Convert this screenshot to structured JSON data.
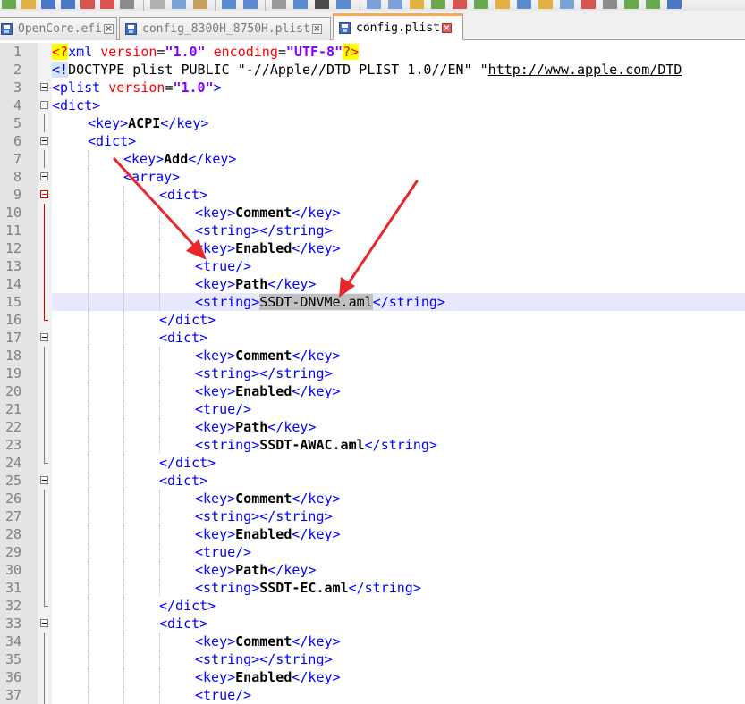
{
  "tabs": [
    {
      "label": "OpenCore.efi",
      "active": false
    },
    {
      "label": "config_8300H_8750H.plist",
      "active": false
    },
    {
      "label": "config.plist",
      "active": true
    }
  ],
  "current_line": 15,
  "lines": [
    {
      "n": 1,
      "indent": 0,
      "fold": "none",
      "tokens": [
        [
          "decl",
          "<?"
        ],
        [
          "tag",
          "xml "
        ],
        [
          "attr",
          "version"
        ],
        [
          "plain",
          "="
        ],
        [
          "val",
          "\"1.0\""
        ],
        [
          "plain",
          " "
        ],
        [
          "attr",
          "encoding"
        ],
        [
          "plain",
          "="
        ],
        [
          "val",
          "\"UTF-8\""
        ],
        [
          "decl",
          "?>"
        ]
      ]
    },
    {
      "n": 2,
      "indent": 0,
      "fold": "none",
      "tokens": [
        [
          "doct",
          "<!"
        ],
        [
          "plain",
          "DOCTYPE plist PUBLIC \"-//Apple//DTD PLIST 1.0//EN\" \""
        ],
        [
          "url",
          "http://www.apple.com/DTD"
        ]
      ]
    },
    {
      "n": 3,
      "indent": 0,
      "fold": "box",
      "tokens": [
        [
          "tag",
          "<plist "
        ],
        [
          "attr",
          "version"
        ],
        [
          "plain",
          "="
        ],
        [
          "val",
          "\"1.0\""
        ],
        [
          "tag",
          ">"
        ]
      ]
    },
    {
      "n": 4,
      "indent": 0,
      "fold": "box",
      "tokens": [
        [
          "tag",
          "<dict>"
        ]
      ]
    },
    {
      "n": 5,
      "indent": 1,
      "fold": "line",
      "tokens": [
        [
          "tag",
          "<key>"
        ],
        [
          "txt",
          "ACPI"
        ],
        [
          "tag",
          "</key>"
        ]
      ]
    },
    {
      "n": 6,
      "indent": 1,
      "fold": "box",
      "tokens": [
        [
          "tag",
          "<dict>"
        ]
      ]
    },
    {
      "n": 7,
      "indent": 2,
      "fold": "line",
      "tokens": [
        [
          "tag",
          "<key>"
        ],
        [
          "txt",
          "Add"
        ],
        [
          "tag",
          "</key>"
        ]
      ]
    },
    {
      "n": 8,
      "indent": 2,
      "fold": "box",
      "tokens": [
        [
          "tag",
          "<array>"
        ]
      ]
    },
    {
      "n": 9,
      "indent": 3,
      "fold": "boxred",
      "tokens": [
        [
          "tag",
          "<dict>"
        ]
      ]
    },
    {
      "n": 10,
      "indent": 4,
      "fold": "linered",
      "tokens": [
        [
          "tag",
          "<key>"
        ],
        [
          "txt",
          "Comment"
        ],
        [
          "tag",
          "</key>"
        ]
      ]
    },
    {
      "n": 11,
      "indent": 4,
      "fold": "linered",
      "tokens": [
        [
          "tag",
          "<string></string>"
        ]
      ]
    },
    {
      "n": 12,
      "indent": 4,
      "fold": "linered",
      "tokens": [
        [
          "tag",
          "<key>"
        ],
        [
          "txt",
          "Enabled"
        ],
        [
          "tag",
          "</key>"
        ]
      ]
    },
    {
      "n": 13,
      "indent": 4,
      "fold": "linered",
      "tokens": [
        [
          "tag",
          "<true/>"
        ]
      ]
    },
    {
      "n": 14,
      "indent": 4,
      "fold": "linered",
      "tokens": [
        [
          "tag",
          "<key>"
        ],
        [
          "txt",
          "Path"
        ],
        [
          "tag",
          "</key>"
        ]
      ]
    },
    {
      "n": 15,
      "indent": 4,
      "fold": "linered",
      "tokens": [
        [
          "tag",
          "<string>"
        ],
        [
          "sel",
          "SSDT-DNVMe.aml"
        ],
        [
          "tag",
          "</string>"
        ]
      ]
    },
    {
      "n": 16,
      "indent": 3,
      "fold": "endred",
      "tokens": [
        [
          "tag",
          "</dict>"
        ]
      ]
    },
    {
      "n": 17,
      "indent": 3,
      "fold": "box",
      "tokens": [
        [
          "tag",
          "<dict>"
        ]
      ]
    },
    {
      "n": 18,
      "indent": 4,
      "fold": "line",
      "tokens": [
        [
          "tag",
          "<key>"
        ],
        [
          "txt",
          "Comment"
        ],
        [
          "tag",
          "</key>"
        ]
      ]
    },
    {
      "n": 19,
      "indent": 4,
      "fold": "line",
      "tokens": [
        [
          "tag",
          "<string></string>"
        ]
      ]
    },
    {
      "n": 20,
      "indent": 4,
      "fold": "line",
      "tokens": [
        [
          "tag",
          "<key>"
        ],
        [
          "txt",
          "Enabled"
        ],
        [
          "tag",
          "</key>"
        ]
      ]
    },
    {
      "n": 21,
      "indent": 4,
      "fold": "line",
      "tokens": [
        [
          "tag",
          "<true/>"
        ]
      ]
    },
    {
      "n": 22,
      "indent": 4,
      "fold": "line",
      "tokens": [
        [
          "tag",
          "<key>"
        ],
        [
          "txt",
          "Path"
        ],
        [
          "tag",
          "</key>"
        ]
      ]
    },
    {
      "n": 23,
      "indent": 4,
      "fold": "line",
      "tokens": [
        [
          "tag",
          "<string>"
        ],
        [
          "txt",
          "SSDT-AWAC.aml"
        ],
        [
          "tag",
          "</string>"
        ]
      ]
    },
    {
      "n": 24,
      "indent": 3,
      "fold": "end",
      "tokens": [
        [
          "tag",
          "</dict>"
        ]
      ]
    },
    {
      "n": 25,
      "indent": 3,
      "fold": "box",
      "tokens": [
        [
          "tag",
          "<dict>"
        ]
      ]
    },
    {
      "n": 26,
      "indent": 4,
      "fold": "line",
      "tokens": [
        [
          "tag",
          "<key>"
        ],
        [
          "txt",
          "Comment"
        ],
        [
          "tag",
          "</key>"
        ]
      ]
    },
    {
      "n": 27,
      "indent": 4,
      "fold": "line",
      "tokens": [
        [
          "tag",
          "<string></string>"
        ]
      ]
    },
    {
      "n": 28,
      "indent": 4,
      "fold": "line",
      "tokens": [
        [
          "tag",
          "<key>"
        ],
        [
          "txt",
          "Enabled"
        ],
        [
          "tag",
          "</key>"
        ]
      ]
    },
    {
      "n": 29,
      "indent": 4,
      "fold": "line",
      "tokens": [
        [
          "tag",
          "<true/>"
        ]
      ]
    },
    {
      "n": 30,
      "indent": 4,
      "fold": "line",
      "tokens": [
        [
          "tag",
          "<key>"
        ],
        [
          "txt",
          "Path"
        ],
        [
          "tag",
          "</key>"
        ]
      ]
    },
    {
      "n": 31,
      "indent": 4,
      "fold": "line",
      "tokens": [
        [
          "tag",
          "<string>"
        ],
        [
          "txt",
          "SSDT-EC.aml"
        ],
        [
          "tag",
          "</string>"
        ]
      ]
    },
    {
      "n": 32,
      "indent": 3,
      "fold": "end",
      "tokens": [
        [
          "tag",
          "</dict>"
        ]
      ]
    },
    {
      "n": 33,
      "indent": 3,
      "fold": "box",
      "tokens": [
        [
          "tag",
          "<dict>"
        ]
      ]
    },
    {
      "n": 34,
      "indent": 4,
      "fold": "line",
      "tokens": [
        [
          "tag",
          "<key>"
        ],
        [
          "txt",
          "Comment"
        ],
        [
          "tag",
          "</key>"
        ]
      ]
    },
    {
      "n": 35,
      "indent": 4,
      "fold": "line",
      "tokens": [
        [
          "tag",
          "<string></string>"
        ]
      ]
    },
    {
      "n": 36,
      "indent": 4,
      "fold": "line",
      "tokens": [
        [
          "tag",
          "<key>"
        ],
        [
          "txt",
          "Enabled"
        ],
        [
          "tag",
          "</key>"
        ]
      ]
    },
    {
      "n": 37,
      "indent": 4,
      "fold": "line",
      "tokens": [
        [
          "tag",
          "<true/>"
        ]
      ]
    }
  ],
  "colors": {
    "annotation_arrow": "#e8282b",
    "active_tab_accent": "#fca94d",
    "current_line": "#e8e8ff"
  }
}
